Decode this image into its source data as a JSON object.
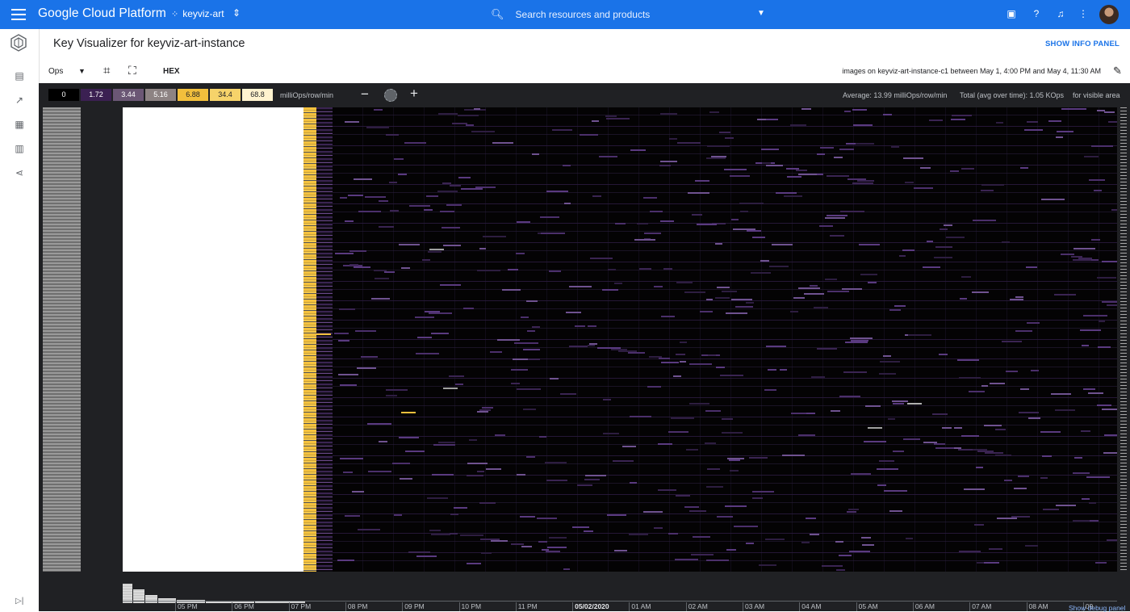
{
  "header": {
    "brand": "Google Cloud Platform",
    "project": "keyviz-art",
    "search_placeholder": "Search resources and products",
    "icons": [
      "menu-icon",
      "project-dots-icon",
      "unfold-icon",
      "search-icon",
      "caret-down-icon",
      "terminal-icon",
      "help-icon",
      "bell-icon",
      "more-vert-icon"
    ]
  },
  "sidenav": {
    "items": [
      "bigtable-logo-icon",
      "instance-icon",
      "monitoring-icon",
      "key-visualizer-icon",
      "tables-icon",
      "replication-icon"
    ],
    "collapse_icon": "collapse-icon"
  },
  "page": {
    "title": "Key Visualizer for keyviz-art-instance",
    "info_panel_label": "SHOW INFO PANEL"
  },
  "toolbar": {
    "metric": "Ops",
    "hex_label": "HEX",
    "range": {
      "prefix": "images",
      "on": "on",
      "cluster": "keyviz-art-instance-c1",
      "between": "between",
      "start": "May 1, 4:00 PM",
      "and": "and",
      "end": "May 4, 11:30 AM"
    }
  },
  "legend": {
    "stops": [
      {
        "label": "0",
        "bg": "#000000",
        "fg": "#ffffff"
      },
      {
        "label": "1.72",
        "bg": "#3b2052",
        "fg": "#ffffff"
      },
      {
        "label": "3.44",
        "bg": "#6b5775",
        "fg": "#ffffff"
      },
      {
        "label": "5.16",
        "bg": "#8d8383",
        "fg": "#ffffff"
      },
      {
        "label": "6.88",
        "bg": "#f2bf3c",
        "fg": "#202124"
      },
      {
        "label": "34.4",
        "bg": "#f6d36a",
        "fg": "#202124"
      },
      {
        "label": "68.8",
        "bg": "#fff3cf",
        "fg": "#202124"
      }
    ],
    "unit": "milliOps/row/min"
  },
  "stats": {
    "average": "Average: 13.99 milliOps/row/min",
    "total": "Total (avg over time): 1.05 KOps",
    "scope": "for visible area"
  },
  "time_axis": {
    "ticks": [
      "05 PM",
      "06 PM",
      "07 PM",
      "08 PM",
      "09 PM",
      "10 PM",
      "11 PM",
      "05/02/2020",
      "01 AM",
      "02 AM",
      "03 AM",
      "04 AM",
      "05 AM",
      "06 AM",
      "07 AM",
      "08 AM",
      "09"
    ]
  },
  "debug_link": "Show debug panel",
  "colors": {
    "header_blue": "#1a73e8",
    "heat_high": "#ffffff",
    "heat_mid": "#f4c13e",
    "heat_low": "#3b2052",
    "heat_zero": "#050405"
  }
}
